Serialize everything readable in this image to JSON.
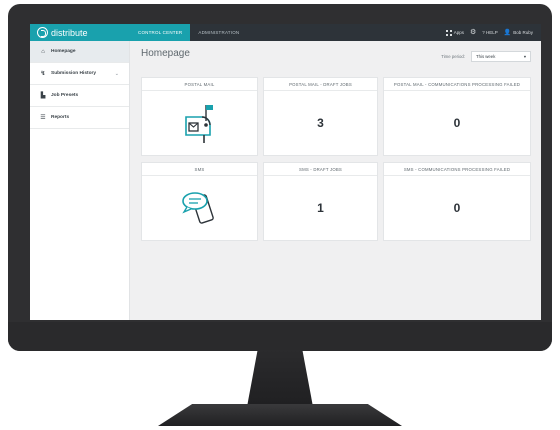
{
  "brand": {
    "name": "distribute"
  },
  "topnav": {
    "tabs": [
      {
        "label": "CONTROL CENTER",
        "active": true
      },
      {
        "label": "ADMINISTRATION",
        "active": false
      }
    ],
    "apps_label": "Apps",
    "help_label": "? HELP",
    "user_name": "Bob Ruby"
  },
  "sidebar": {
    "items": [
      {
        "label": "Homepage",
        "icon": "home-icon",
        "active": true
      },
      {
        "label": "Submission History",
        "icon": "history-icon",
        "active": false,
        "has_chevron": true
      },
      {
        "label": "Job Presets",
        "icon": "document-icon",
        "active": false
      },
      {
        "label": "Reports",
        "icon": "report-icon",
        "active": false
      }
    ]
  },
  "main": {
    "title": "Homepage",
    "time_period_label": "Time period:",
    "time_period_value": "This week"
  },
  "cards": [
    {
      "title": "POSTAL MAIL",
      "icon": "mailbox-icon"
    },
    {
      "title": "POSTAL MAIL - DRAFT JOBS",
      "value": "3"
    },
    {
      "title": "POSTAL MAIL - COMMUNICATIONS PROCESSING FAILED",
      "value": "0"
    },
    {
      "title": "SMS",
      "icon": "sms-phone-icon"
    },
    {
      "title": "SMS - DRAFT JOBS",
      "value": "1"
    },
    {
      "title": "SMS - COMMUNICATIONS PROCESSING FAILED",
      "value": "0"
    }
  ],
  "colors": {
    "accent": "#19a1ad",
    "topbar": "#2d3339",
    "monitor": "#2f2f31"
  }
}
